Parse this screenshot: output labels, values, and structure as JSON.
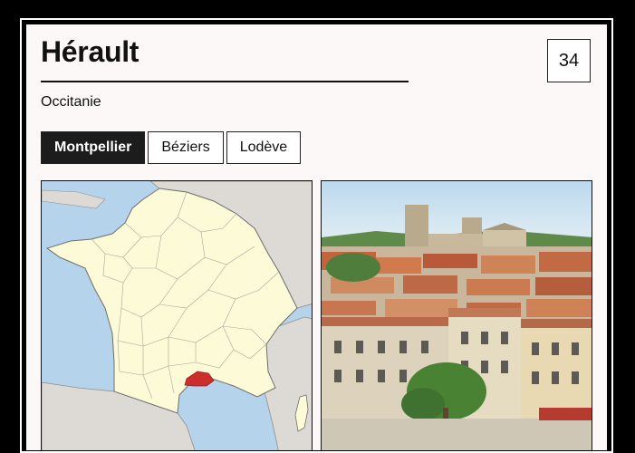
{
  "department": {
    "name": "Hérault",
    "region": "Occitanie",
    "code": "34"
  },
  "tabs": [
    {
      "label": "Montpellier",
      "active": true
    },
    {
      "label": "Béziers",
      "active": false
    },
    {
      "label": "Lodève",
      "active": false
    }
  ],
  "colors": {
    "highlight": "#cc2d2d",
    "france_fill": "#fdfbd7",
    "sea": "#b5d3ea",
    "tab_active_bg": "#1c1c1c",
    "card_bg": "#fcf8f7"
  }
}
